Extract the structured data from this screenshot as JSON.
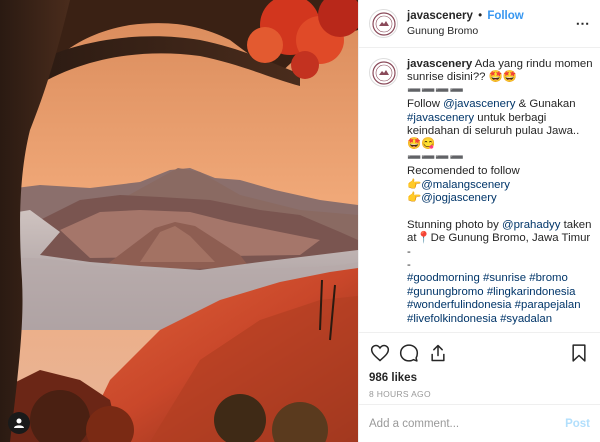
{
  "post": {
    "username": "javascenery",
    "separator": "•",
    "follow_label": "Follow",
    "location": "Gunung Bromo",
    "more_icon": "more-horizontal-icon"
  },
  "caption": {
    "lines": [
      [
        {
          "t": "javascenery",
          "cls": "cap-user"
        },
        {
          "t": " Ada yang rindu momen"
        }
      ],
      [
        {
          "t": "sunrise disini?? 🤩🤩"
        }
      ],
      [
        {
          "t": "➖➖➖➖"
        }
      ],
      [
        {
          "t": "Follow "
        },
        {
          "t": "@javascenery",
          "cls": "link"
        },
        {
          "t": " & Gunakan"
        }
      ],
      [
        {
          "t": "#javascenery",
          "cls": "link"
        },
        {
          "t": " untuk berbagi"
        }
      ],
      [
        {
          "t": "keindahan di seluruh pulau Jawa.."
        }
      ],
      [
        {
          "t": "🤩😋"
        }
      ],
      [
        {
          "t": "➖➖➖➖"
        }
      ],
      [
        {
          "t": "Recomended to follow"
        }
      ],
      [
        {
          "t": "👉"
        },
        {
          "t": "@malangscenery",
          "cls": "link"
        }
      ],
      [
        {
          "t": "👉"
        },
        {
          "t": "@jogjascenery",
          "cls": "link"
        }
      ],
      [
        {
          "t": ""
        }
      ],
      [
        {
          "t": "Stunning photo by "
        },
        {
          "t": "@prahadyy",
          "cls": "link"
        },
        {
          "t": " taken"
        }
      ],
      [
        {
          "t": "at📍De Gunung Bromo, Jawa Timur"
        }
      ],
      [
        {
          "t": "-"
        }
      ],
      [
        {
          "t": "-"
        }
      ],
      [
        {
          "t": "#goodmorning",
          "cls": "link"
        },
        {
          "t": " "
        },
        {
          "t": "#sunrise",
          "cls": "link"
        },
        {
          "t": " "
        },
        {
          "t": "#bromo",
          "cls": "link"
        }
      ],
      [
        {
          "t": "#gunungbromo",
          "cls": "link"
        },
        {
          "t": " "
        },
        {
          "t": "#lingkarindonesia",
          "cls": "link"
        }
      ],
      [
        {
          "t": "#wonderfulindonesia",
          "cls": "link"
        },
        {
          "t": " "
        },
        {
          "t": "#parapejalan",
          "cls": "link"
        }
      ],
      [
        {
          "t": "#livefolkindonesia",
          "cls": "link"
        },
        {
          "t": " "
        },
        {
          "t": "#syadalan",
          "cls": "link"
        }
      ]
    ]
  },
  "actions": {
    "icons": [
      "heart-icon",
      "comment-icon",
      "share-icon",
      "bookmark-icon"
    ],
    "likes": "986 likes",
    "timestamp": "8 HOURS AGO"
  },
  "comment_box": {
    "placeholder": "Add a comment...",
    "post_label": "Post"
  },
  "colors": {
    "link": "#003569",
    "follow": "#3897f0",
    "post_disabled": "#b2dffc"
  }
}
